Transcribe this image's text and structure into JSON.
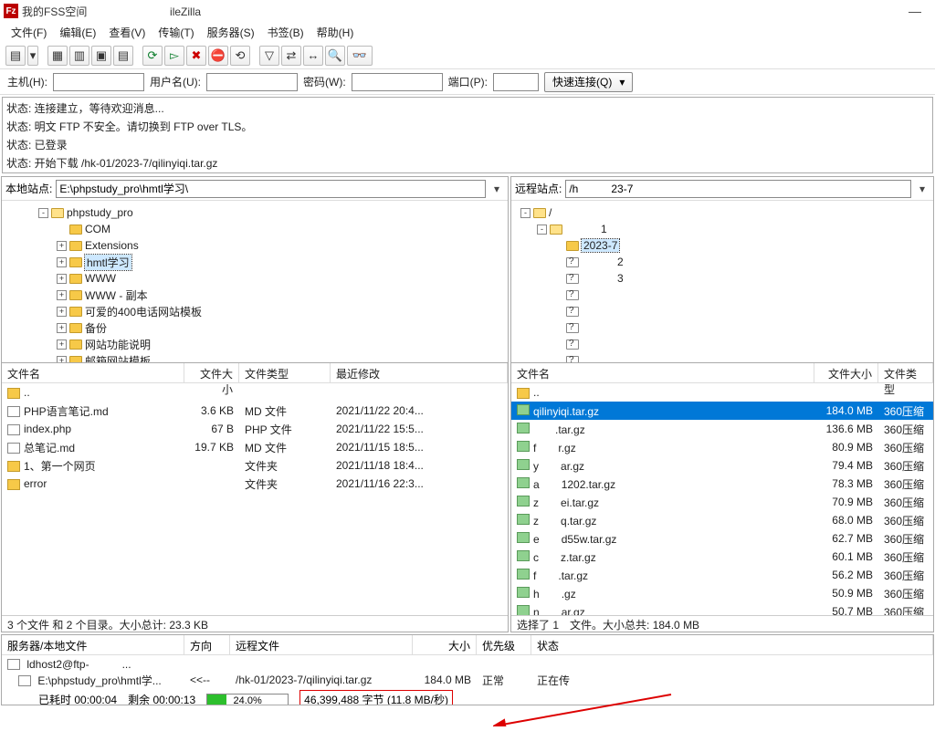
{
  "title": {
    "left": "我的FSS空间",
    "right": "ileZilla"
  },
  "menu": [
    "文件(F)",
    "编辑(E)",
    "查看(V)",
    "传输(T)",
    "服务器(S)",
    "书签(B)",
    "帮助(H)"
  ],
  "quickconnect": {
    "host_label": "主机(H):",
    "user_label": "用户名(U):",
    "pass_label": "密码(W):",
    "port_label": "端口(P):",
    "button": "快速连接(Q)"
  },
  "status": [
    "状态:\t连接建立，等待欢迎消息...",
    "状态:\t明文 FTP 不安全。请切换到 FTP over TLS。",
    "状态:\t已登录",
    "状态:\t开始下载 /hk-01/2023-7/qilinyiqi.tar.gz"
  ],
  "local": {
    "site_label": "本地站点:",
    "path": "E:\\phpstudy_pro\\hmtl学习\\",
    "tree": [
      {
        "ind": 40,
        "exp": "-",
        "open": true,
        "label": "phpstudy_pro"
      },
      {
        "ind": 60,
        "exp": "",
        "label": "COM"
      },
      {
        "ind": 60,
        "exp": "+",
        "label": "Extensions"
      },
      {
        "ind": 60,
        "exp": "+",
        "label": "hmtl学习",
        "sel": true
      },
      {
        "ind": 60,
        "exp": "+",
        "label": "WWW"
      },
      {
        "ind": 60,
        "exp": "+",
        "label": "WWW - 副本"
      },
      {
        "ind": 60,
        "exp": "+",
        "label": "可爱的400电话网站模板"
      },
      {
        "ind": 60,
        "exp": "+",
        "label": "备份"
      },
      {
        "ind": 60,
        "exp": "+",
        "label": "网站功能说明"
      },
      {
        "ind": 60,
        "exp": "+",
        "label": "邮箱网站模板"
      }
    ],
    "cols": {
      "name": "文件名",
      "size": "文件大小",
      "type": "文件类型",
      "mod": "最近修改"
    },
    "files": [
      {
        "icon": "fld",
        "name": "..",
        "size": "",
        "type": "",
        "mod": ""
      },
      {
        "icon": "file",
        "name": "PHP语言笔记.md",
        "size": "3.6 KB",
        "type": "MD 文件",
        "mod": "2021/11/22 20:4..."
      },
      {
        "icon": "file",
        "name": "index.php",
        "size": "67 B",
        "type": "PHP 文件",
        "mod": "2021/11/22 15:5..."
      },
      {
        "icon": "file",
        "name": "总笔记.md",
        "size": "19.7 KB",
        "type": "MD 文件",
        "mod": "2021/11/15 18:5..."
      },
      {
        "icon": "fld",
        "name": "1、第一个网页",
        "size": "",
        "type": "文件夹",
        "mod": "2021/11/18 18:4..."
      },
      {
        "icon": "fld",
        "name": "error",
        "size": "",
        "type": "文件夹",
        "mod": "2021/11/16 22:3..."
      }
    ],
    "status": "3 个文件 和 2 个目录。大小总计: 23.3 KB"
  },
  "remote": {
    "site_label": "远程站点:",
    "path_prefix": "/h",
    "path_suffix": "23-7",
    "tree": [
      {
        "ind": 10,
        "exp": "-",
        "open": true,
        "label": "/"
      },
      {
        "ind": 28,
        "exp": "-",
        "open": true,
        "label": "1",
        "blur": true
      },
      {
        "ind": 46,
        "exp": "",
        "label": "2023-7",
        "sel": true
      },
      {
        "ind": 46,
        "exp": "?",
        "label": "2",
        "blur": true
      },
      {
        "ind": 46,
        "exp": "?",
        "label": "3",
        "blur": true
      },
      {
        "ind": 46,
        "exp": "?",
        "label": "",
        "blur": true
      },
      {
        "ind": 46,
        "exp": "?",
        "label": "",
        "blur": true
      },
      {
        "ind": 46,
        "exp": "?",
        "label": "",
        "blur": true
      },
      {
        "ind": 46,
        "exp": "?",
        "label": "",
        "blur": true
      },
      {
        "ind": 46,
        "exp": "?",
        "label": "",
        "blur": true
      }
    ],
    "cols": {
      "name": "文件名",
      "size": "文件大小",
      "type": "文件类型"
    },
    "files": [
      {
        "icon": "fld",
        "name": "..",
        "size": "",
        "type": ""
      },
      {
        "icon": "arch",
        "name": "qilinyiqi.tar.gz",
        "size": "184.0 MB",
        "type": "360压缩",
        "sel": true
      },
      {
        "icon": "arch",
        "pre": "",
        "suf": ".tar.gz",
        "blur": true,
        "size": "136.6 MB",
        "type": "360压缩"
      },
      {
        "icon": "arch",
        "pre": "f",
        "suf": "r.gz",
        "blur": true,
        "size": "80.9 MB",
        "type": "360压缩"
      },
      {
        "icon": "arch",
        "pre": "y",
        "suf": "ar.gz",
        "blur": true,
        "size": "79.4 MB",
        "type": "360压缩"
      },
      {
        "icon": "arch",
        "pre": "a",
        "suf": "1202.tar.gz",
        "blur": true,
        "size": "78.3 MB",
        "type": "360压缩"
      },
      {
        "icon": "arch",
        "pre": "z",
        "suf": "ei.tar.gz",
        "blur": true,
        "size": "70.9 MB",
        "type": "360压缩"
      },
      {
        "icon": "arch",
        "pre": "z",
        "suf": "q.tar.gz",
        "blur": true,
        "size": "68.0 MB",
        "type": "360压缩"
      },
      {
        "icon": "arch",
        "pre": "e",
        "suf": "d55w.tar.gz",
        "blur": true,
        "size": "62.7 MB",
        "type": "360压缩"
      },
      {
        "icon": "arch",
        "pre": "c",
        "suf": "z.tar.gz",
        "blur": true,
        "size": "60.1 MB",
        "type": "360压缩"
      },
      {
        "icon": "arch",
        "pre": "f",
        "suf": ".tar.gz",
        "blur": true,
        "size": "56.2 MB",
        "type": "360压缩"
      },
      {
        "icon": "arch",
        "pre": "h",
        "suf": ".gz",
        "blur": true,
        "size": "50.9 MB",
        "type": "360压缩"
      },
      {
        "icon": "arch",
        "pre": "n",
        "suf": "ar.gz",
        "blur": true,
        "size": "50.7 MB",
        "type": "360压缩"
      }
    ],
    "status_pre": "选择了 1",
    "status_suf": "文件。大小总共: 184.0 MB"
  },
  "queue": {
    "cols": {
      "c1": "服务器/本地文件",
      "c2": "方向",
      "c3": "远程文件",
      "c4": "大小",
      "c5": "优先级",
      "c6": "状态"
    },
    "server": {
      "pre": "ldhost2@ftp-",
      "suf": "..."
    },
    "row": {
      "local": "E:\\phpstudy_pro\\hmtl学...",
      "dir": "<<--",
      "remote": "/hk-01/2023-7/qilinyiqi.tar.gz",
      "size": "184.0 MB",
      "prio": "正常",
      "status": "正在传"
    },
    "progress": {
      "elapsed_label": "已耗时",
      "elapsed": "00:00:04",
      "remain_label": "剩余",
      "remain": "00:00:13",
      "pct": "24.0%",
      "pct_val": 24,
      "bytes": "46,399,488 字节 (11.8 MB/秒)"
    }
  }
}
